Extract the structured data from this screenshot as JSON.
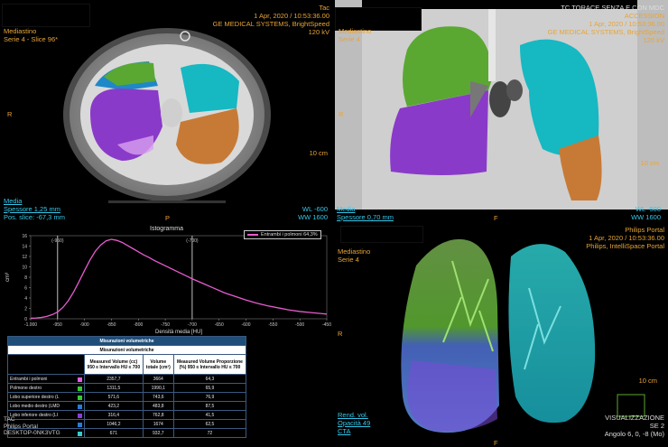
{
  "viewport1": {
    "top_right": [
      "Tac",
      "1 Apr, 2020 / 10:53:36.00",
      "GE MEDICAL SYSTEMS, BrightSpeed",
      "120 kV"
    ],
    "top_left": [
      "Mediastino",
      "Serie 4 - Slice 96*"
    ],
    "left_marker": "R",
    "scale": "10 cm",
    "bottom_left": [
      "Media",
      "Spessore 1,25 mm",
      "Pos. slice: -67,3 mm"
    ],
    "bottom_right": [
      "WL  -600",
      "WW  1600"
    ],
    "bottom_marker": "P"
  },
  "viewport2": {
    "top_right": [
      "TC TORACE SENZA E CON MDC",
      "ACCESSION",
      "1 Apr, 2020 / 10:53:36.00",
      "GE MEDICAL SYSTEMS, BrightSpeed",
      "120 kV"
    ],
    "top_left": [
      "Mediastino",
      "Serie 4"
    ],
    "left_marker": "R",
    "scale": "10 cm",
    "bottom_left": [
      "Media",
      "Spessore 0,70 mm"
    ],
    "bottom_right": [
      "WL  -500",
      "WW  1600"
    ],
    "bottom_marker": "F"
  },
  "histogram": {
    "title": "Istogramma",
    "legend": "Entrambi i polmoni 64,3%",
    "ylabel": "cm³",
    "xlabel": "Densità media [HU]",
    "marker_left": "(-950)",
    "marker_right": "(-700)"
  },
  "chart_data": {
    "type": "line",
    "title": "Istogramma",
    "xlabel": "Densità media [HU]",
    "ylabel": "cm³",
    "xlim": [
      -1000,
      -450
    ],
    "ylim": [
      0,
      16
    ],
    "x_ticks": [
      "-1.000",
      "-950",
      "-900",
      "-850",
      "-800",
      "-750",
      "-700",
      "-650",
      "-600",
      "-550",
      "-500",
      "-450"
    ],
    "y_ticks": [
      "0",
      "2",
      "4",
      "6",
      "8",
      "10",
      "12",
      "14",
      "16"
    ],
    "vlines": [
      -950,
      -700
    ],
    "series": [
      {
        "name": "Entrambi i polmoni 64,3%",
        "color": "#e85bd0",
        "x": [
          -1000,
          -990,
          -980,
          -970,
          -960,
          -950,
          -940,
          -930,
          -920,
          -910,
          -900,
          -890,
          -880,
          -870,
          -860,
          -850,
          -840,
          -830,
          -820,
          -810,
          -800,
          -790,
          -780,
          -770,
          -760,
          -750,
          -740,
          -730,
          -720,
          -710,
          -700,
          -680,
          -660,
          -640,
          -620,
          -600,
          -580,
          -560,
          -540,
          -520,
          -500,
          -480,
          -460,
          -450
        ],
        "y": [
          0.1,
          0.15,
          0.25,
          0.45,
          0.8,
          1.3,
          2.2,
          3.5,
          5.2,
          7.2,
          9.3,
          11.3,
          13.0,
          14.2,
          15.0,
          15.3,
          15.1,
          14.7,
          14.1,
          13.5,
          12.9,
          12.3,
          11.8,
          11.2,
          10.7,
          10.2,
          9.7,
          9.2,
          8.7,
          8.2,
          7.7,
          6.8,
          5.9,
          5.0,
          4.3,
          3.6,
          3.0,
          2.5,
          2.1,
          1.7,
          1.4,
          1.2,
          1.0,
          0.9
        ]
      }
    ]
  },
  "table": {
    "title": "Misurazioni volumetriche",
    "subtitle": "Misurazioni volumetriche",
    "col1": "Measured Volume (cc) 950 ≤ Intervallo HU ≤ 700",
    "col2": "Volume totale (cm³)",
    "col3": "Measured Volume Proporzione (%) 950 ≤ Intervallo HU ≤ 700",
    "rows": [
      {
        "name": "Entrambi i polmoni",
        "color": "#e060e0",
        "v1": "2357,7",
        "v2": "3664",
        "v3": "64,3"
      },
      {
        "name": "Polmone destro",
        "color": "#33cc33",
        "v1": "1311,5",
        "v2": "1990,1",
        "v3": "65,9"
      },
      {
        "name": "Lobo superiore destro (L",
        "color": "#33cc33",
        "v1": "571,6",
        "v2": "743,6",
        "v3": "76,9"
      },
      {
        "name": "Lobo medio destro (LMD",
        "color": "#2a7ad8",
        "v1": "423,2",
        "v2": "483,8",
        "v3": "87,5"
      },
      {
        "name": "Lobo inferiore destro (LI",
        "color": "#8e3ad8",
        "v1": "316,4",
        "v2": "762,8",
        "v3": "41,5"
      },
      {
        "name": "",
        "color": "#2a7ad8",
        "v1": "1046,2",
        "v2": "1674",
        "v3": "62,5"
      },
      {
        "name": "",
        "color": "#33cccc",
        "v1": "671",
        "v2": "932,7",
        "v3": "72"
      }
    ]
  },
  "viewport3_overlay": [
    "TAC",
    "Philips Portal",
    "DESKTOP-0NK3VTG"
  ],
  "viewport4": {
    "top_right": [
      "Philips Portal",
      "1 Apr, 2020 / 10:53:36.00",
      "Philips, IntelliSpace Portal"
    ],
    "top_left": [
      "Mediastino",
      "Serie 4"
    ],
    "left_marker": "R",
    "scale": "10 cm",
    "bottom_left": [
      "Rend. vol.",
      "Opacità 49",
      "CTA"
    ],
    "bottom_right": [
      "VISUALIZZAZIONE",
      "SE 2",
      "Angolo 6, 0, -8 (Mo)"
    ],
    "bottom_marker": "F"
  }
}
